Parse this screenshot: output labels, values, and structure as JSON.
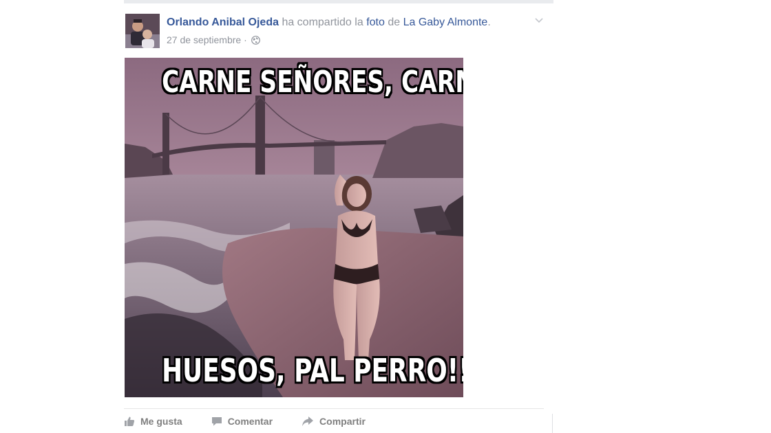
{
  "post": {
    "author": "Orlando Anibal Ojeda",
    "shared_text": "ha compartido la",
    "object": "foto",
    "preposition": "de",
    "original_owner": "La Gaby Almonte",
    "period": ".",
    "timestamp": "27 de septiembre",
    "separator": "·",
    "audience_icon": "globe-icon",
    "options_icon": "chevron-down-icon"
  },
  "photo": {
    "top_caption": "CARNE SEÑORES, CARNE",
    "bottom_caption": "HUESOS, PAL PERRO!!!"
  },
  "actions": {
    "like_label": "Me gusta",
    "like_icon": "thumbs-up-icon",
    "comment_label": "Comentar",
    "comment_icon": "speech-bubble-icon",
    "share_label": "Compartir",
    "share_icon": "share-arrow-icon"
  },
  "colors": {
    "link": "#365899",
    "muted": "#90949c",
    "action": "#7f7f7f"
  }
}
